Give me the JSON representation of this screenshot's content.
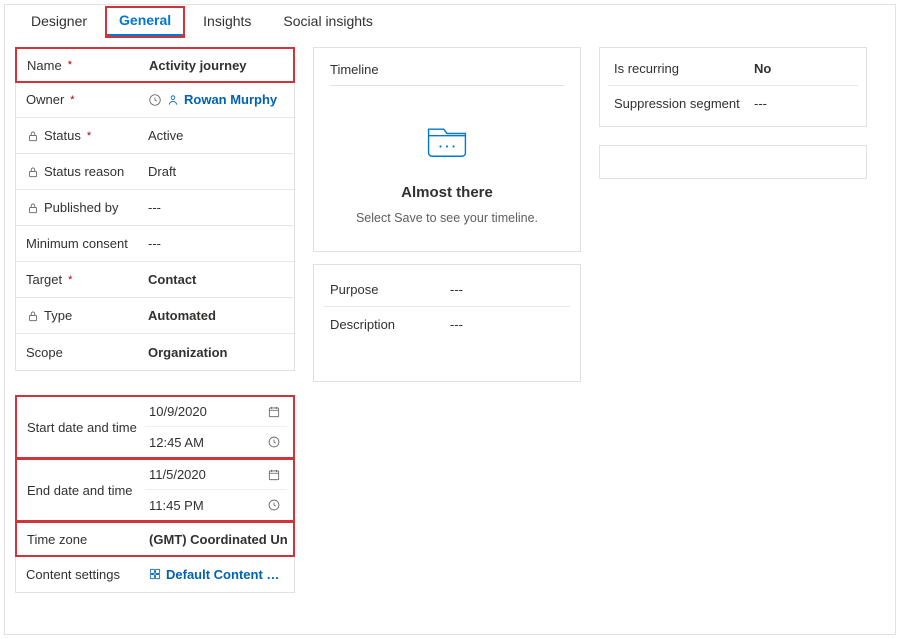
{
  "tabs": {
    "designer": "Designer",
    "general": "General",
    "insights": "Insights",
    "social": "Social insights"
  },
  "left1": {
    "name_label": "Name",
    "name_value": "Activity journey",
    "owner_label": "Owner",
    "owner_value": "Rowan Murphy",
    "status_label": "Status",
    "status_value": "Active",
    "status_reason_label": "Status reason",
    "status_reason_value": "Draft",
    "published_by_label": "Published by",
    "published_by_value": "---",
    "min_consent_label": "Minimum consent",
    "min_consent_value": "---",
    "target_label": "Target",
    "target_value": "Contact",
    "type_label": "Type",
    "type_value": "Automated",
    "scope_label": "Scope",
    "scope_value": "Organization"
  },
  "left2": {
    "start_label": "Start date and time",
    "start_date": "10/9/2020",
    "start_time": "12:45 AM",
    "end_label": "End date and time",
    "end_date": "11/5/2020",
    "end_time": "11:45 PM",
    "tz_label": "Time zone",
    "tz_value": "(GMT) Coordinated Unive",
    "content_label": "Content settings",
    "content_value": "Default Content Set..."
  },
  "timeline": {
    "title": "Timeline",
    "heading": "Almost there",
    "subtext": "Select Save to see your timeline."
  },
  "meta": {
    "purpose_label": "Purpose",
    "purpose_value": "---",
    "description_label": "Description",
    "description_value": "---"
  },
  "right": {
    "recurring_label": "Is recurring",
    "recurring_value": "No",
    "suppress_label": "Suppression segment",
    "suppress_value": "---"
  }
}
